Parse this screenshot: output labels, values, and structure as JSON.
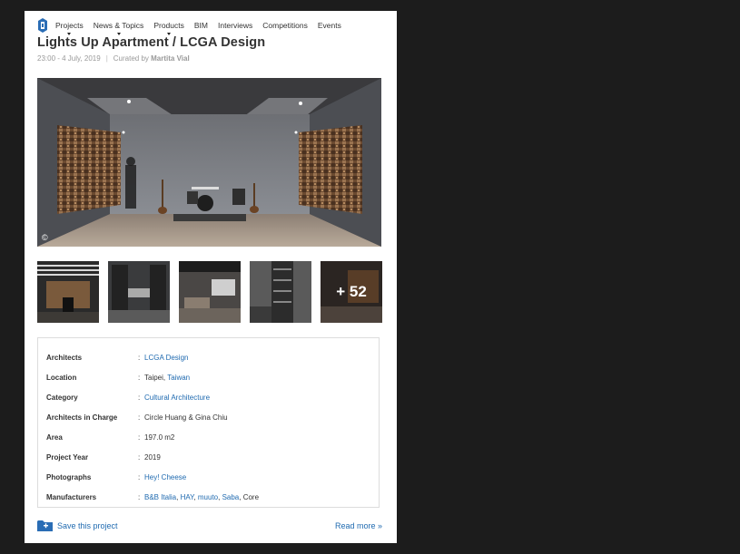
{
  "nav": {
    "items": [
      {
        "label": "Projects",
        "has_dropdown": true
      },
      {
        "label": "News & Topics",
        "has_dropdown": true
      },
      {
        "label": "Products",
        "has_dropdown": true
      },
      {
        "label": "BIM",
        "has_dropdown": false
      },
      {
        "label": "Interviews",
        "has_dropdown": false
      },
      {
        "label": "Competitions",
        "has_dropdown": false
      },
      {
        "label": "Events",
        "has_dropdown": false
      }
    ]
  },
  "article": {
    "title": "Lights Up Apartment / LCGA Design",
    "datetime": "23:00 - 4 July, 2019",
    "curated_prefix": "Curated by",
    "curator": "Martita Vial"
  },
  "hero": {
    "copyright": "©"
  },
  "gallery": {
    "more_count": "+ 52"
  },
  "details": [
    {
      "label": "Architects",
      "parts": [
        {
          "text": "LCGA Design",
          "link": true
        }
      ]
    },
    {
      "label": "Location",
      "parts": [
        {
          "text": "Taipei",
          "link": false
        },
        {
          "text": ", ",
          "link": false
        },
        {
          "text": "Taiwan",
          "link": true
        }
      ]
    },
    {
      "label": "Category",
      "parts": [
        {
          "text": "Cultural Architecture",
          "link": true
        }
      ]
    },
    {
      "label": "Architects in Charge",
      "parts": [
        {
          "text": "Circle Huang & Gina Chiu",
          "link": false
        }
      ]
    },
    {
      "label": "Area",
      "parts": [
        {
          "text": "197.0 m2",
          "link": false
        }
      ]
    },
    {
      "label": "Project Year",
      "parts": [
        {
          "text": "2019",
          "link": false
        }
      ]
    },
    {
      "label": "Photographs",
      "parts": [
        {
          "text": "Hey! Cheese",
          "link": true
        }
      ]
    },
    {
      "label": "Manufacturers",
      "parts": [
        {
          "text": "B&B Italia",
          "link": true
        },
        {
          "text": ", ",
          "link": false
        },
        {
          "text": "HAY",
          "link": true
        },
        {
          "text": ", ",
          "link": false
        },
        {
          "text": "muuto",
          "link": true
        },
        {
          "text": ", ",
          "link": false
        },
        {
          "text": "Saba",
          "link": true
        },
        {
          "text": ", Core",
          "link": false
        }
      ]
    }
  ],
  "footer": {
    "save_label": "Save this project",
    "read_more_label": "Read more »"
  },
  "colors": {
    "link": "#1f6ab0",
    "text": "#333333",
    "muted": "#999999",
    "background": "#1c1c1c"
  }
}
